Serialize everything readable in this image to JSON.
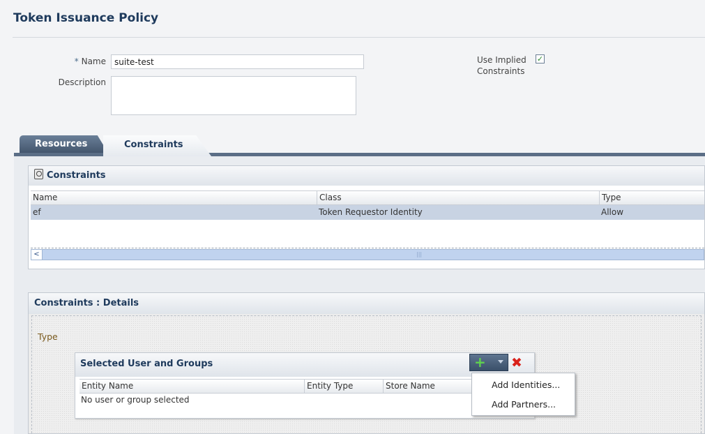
{
  "page": {
    "title": "Token Issuance Policy"
  },
  "form": {
    "name_label": "Name",
    "name_required_marker": "*",
    "name_value": "suite-test",
    "description_label": "Description",
    "description_value": "",
    "implied_label_line1": "Use Implied",
    "implied_label_line2": "Constraints",
    "implied_checked": true,
    "check_mark": "✓"
  },
  "tabs": [
    {
      "label": "Resources",
      "active": false
    },
    {
      "label": "Constraints",
      "active": true
    }
  ],
  "constraints": {
    "title": "Constraints",
    "columns": [
      "Name",
      "Class",
      "Type"
    ],
    "rows": [
      {
        "name": "ef",
        "class": "Token Requestor Identity",
        "type": "Allow"
      }
    ],
    "scroll_left_icon": "<",
    "scroll_grip": "|||"
  },
  "details": {
    "title": "Constraints : Details",
    "type_label": "Type",
    "selected": {
      "title": "Selected User and Groups",
      "columns": [
        "Entity Name",
        "Entity Type",
        "Store Name"
      ],
      "empty_text": "No user or group selected"
    },
    "toolbar": {
      "add_icon": "+",
      "delete_icon": "✖"
    },
    "menu": [
      "Add Identities...",
      "Add Partners..."
    ]
  },
  "colors": {
    "accent": "#1e3a5c",
    "selected_row": "#c8d3e3",
    "add_icon": "#5fd24e",
    "delete_icon": "#d9221c"
  }
}
